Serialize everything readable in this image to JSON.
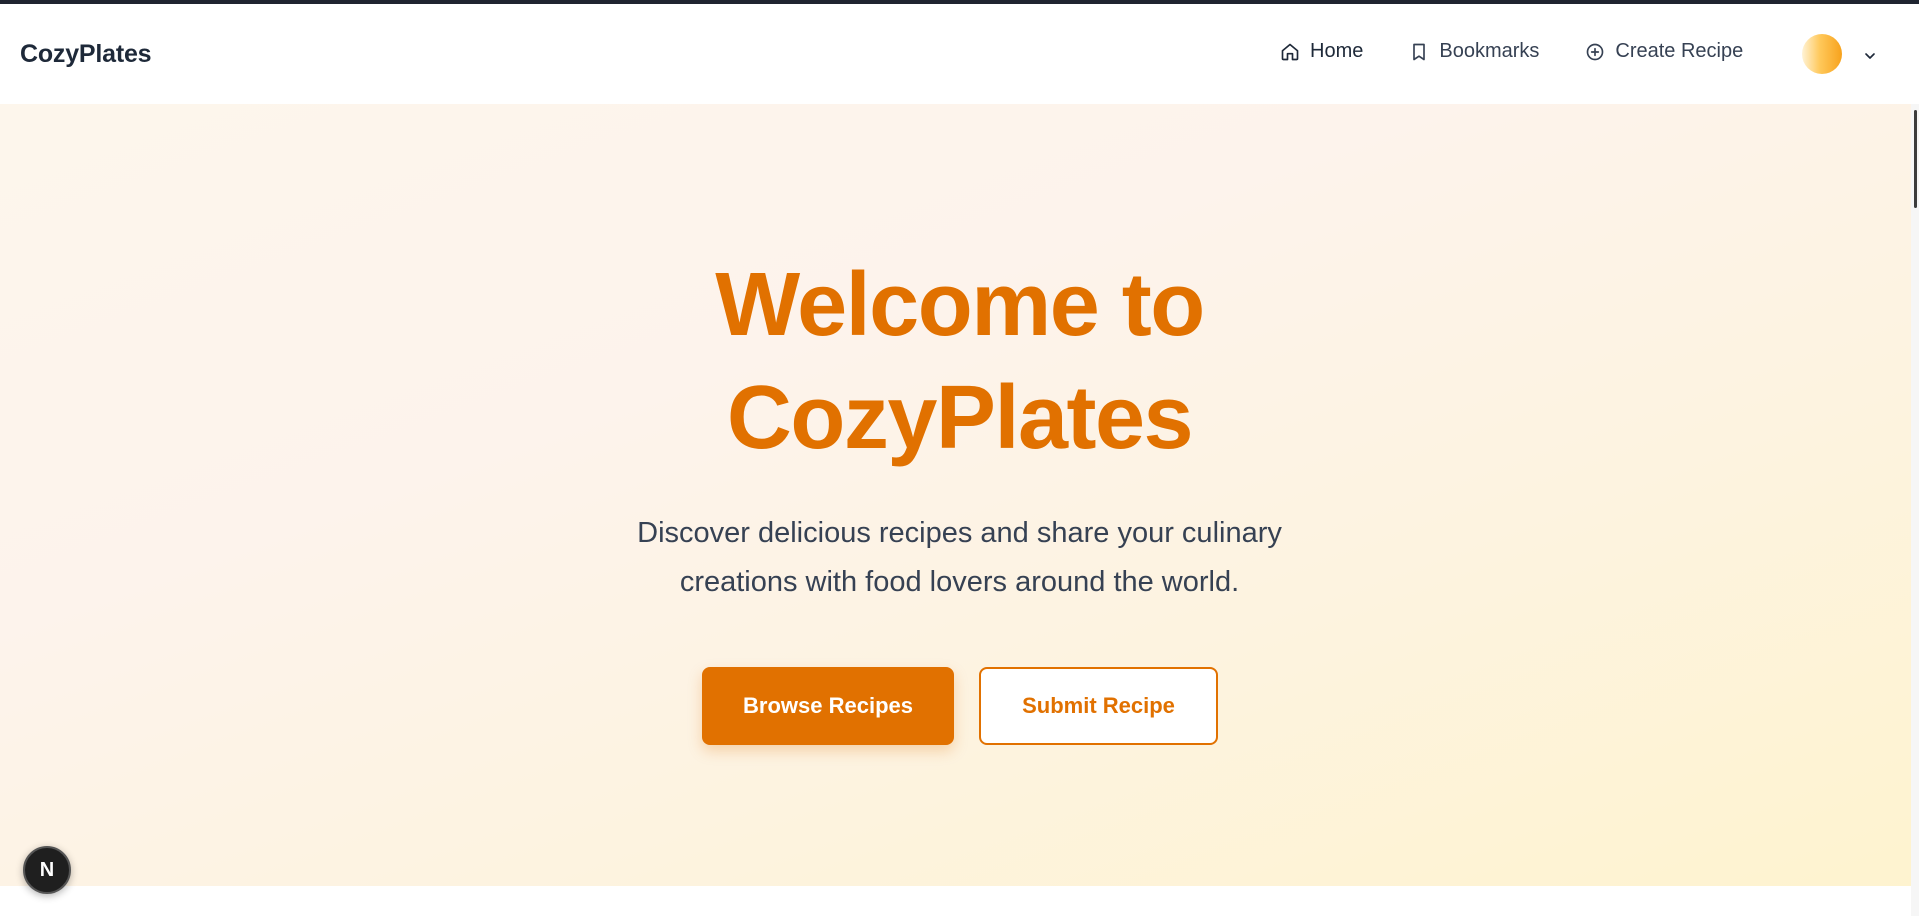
{
  "nav": {
    "brand": "CozyPlates",
    "links": [
      {
        "label": "Home",
        "icon": "home-icon"
      },
      {
        "label": "Bookmarks",
        "icon": "bookmark-icon"
      },
      {
        "label": "Create Recipe",
        "icon": "plus-circle-icon"
      }
    ]
  },
  "hero": {
    "title_line1": "Welcome to",
    "title_line2": "CozyPlates",
    "subtitle_line1": "Discover delicious recipes and share your culinary",
    "subtitle_line2": "creations with food lovers around the world.",
    "primary_button": "Browse Recipes",
    "secondary_button": "Submit Recipe"
  },
  "dev_badge": "N",
  "colors": {
    "accent": "#e17100",
    "text_dark": "#1e2939",
    "text_body": "#364153"
  }
}
